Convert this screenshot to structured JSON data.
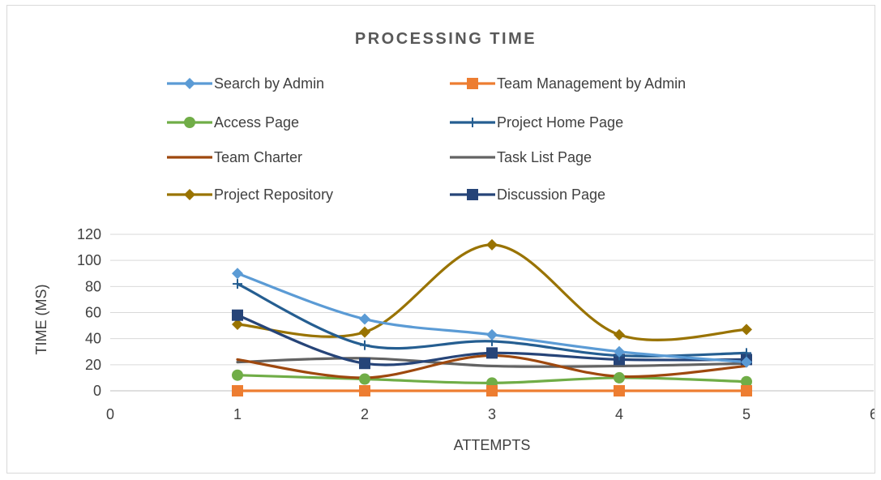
{
  "chart_data": {
    "type": "scatter",
    "title": "PROCESSING TIME",
    "xlabel": "ATTEMPTS",
    "ylabel": "TIME (MS)",
    "xlim": [
      0,
      6
    ],
    "ylim": [
      0,
      120
    ],
    "xticks": [
      0,
      1,
      2,
      3,
      4,
      5,
      6
    ],
    "yticks": [
      0,
      20,
      40,
      60,
      80,
      100,
      120
    ],
    "grid": "horizontal",
    "smooth_lines": true,
    "legend_position": "top",
    "x": [
      1,
      2,
      3,
      4,
      5
    ],
    "series": [
      {
        "name": "Search by Admin",
        "color": "#5B9BD5",
        "marker": "diamond",
        "values": [
          90,
          55,
          43,
          30,
          22
        ]
      },
      {
        "name": "Team Management by Admin",
        "color": "#ED7D31",
        "marker": "square",
        "values": [
          0,
          0,
          0,
          0,
          0
        ]
      },
      {
        "name": "Access Page",
        "color": "#70AD47",
        "marker": "circle",
        "values": [
          12,
          9,
          6,
          10,
          7
        ]
      },
      {
        "name": "Project Home Page",
        "color": "#255E91",
        "marker": "plus",
        "values": [
          82,
          35,
          38,
          27,
          29
        ]
      },
      {
        "name": "Team Charter",
        "color": "#9E480E",
        "marker": "none",
        "values": [
          24,
          10,
          27,
          11,
          19
        ]
      },
      {
        "name": "Task List Page",
        "color": "#636363",
        "marker": "none",
        "values": [
          22,
          25,
          19,
          19,
          21
        ]
      },
      {
        "name": "Project Repository",
        "color": "#997300",
        "marker": "diamond",
        "values": [
          51,
          45,
          112,
          43,
          47
        ]
      },
      {
        "name": "Discussion Page",
        "color": "#264478",
        "marker": "square",
        "values": [
          58,
          21,
          29,
          24,
          24
        ]
      }
    ]
  }
}
